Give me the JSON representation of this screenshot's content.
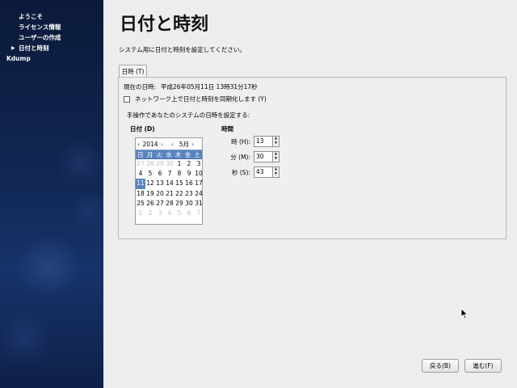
{
  "sidebar": {
    "items": [
      {
        "label": "ようこそ",
        "active": false
      },
      {
        "label": "ライセンス情報",
        "active": false
      },
      {
        "label": "ユーザーの作成",
        "active": false
      },
      {
        "label": "日付と時刻",
        "active": true
      },
      {
        "label": "Kdump",
        "active": false
      }
    ]
  },
  "header": {
    "title": "日付と時刻",
    "subtitle": "システム用に日付と時刻を設定してください。"
  },
  "tab": {
    "label": "日時 (T)"
  },
  "panel": {
    "current_time_label": "現在の日時:",
    "current_time_value": "平成26年05月11日 13時31分17秒",
    "ntp_label": "ネットワーク上で日付と時刻を同期化します (Y)",
    "ntp_checked": false,
    "manual_label": "手操作であなたのシステムの日時を設定する:",
    "date_header": "日付 (D)",
    "time_header": "時間"
  },
  "calendar": {
    "year": "2014",
    "month": "5月",
    "prev_symbol": "‹",
    "next_symbol": "›",
    "weekdays": [
      "日",
      "月",
      "火",
      "水",
      "木",
      "金",
      "土"
    ],
    "days": [
      {
        "d": "27",
        "other": true
      },
      {
        "d": "28",
        "other": true
      },
      {
        "d": "29",
        "other": true
      },
      {
        "d": "30",
        "other": true
      },
      {
        "d": "1"
      },
      {
        "d": "2"
      },
      {
        "d": "3"
      },
      {
        "d": "4"
      },
      {
        "d": "5"
      },
      {
        "d": "6"
      },
      {
        "d": "7"
      },
      {
        "d": "8"
      },
      {
        "d": "9"
      },
      {
        "d": "10"
      },
      {
        "d": "11",
        "selected": true
      },
      {
        "d": "12"
      },
      {
        "d": "13"
      },
      {
        "d": "14"
      },
      {
        "d": "15"
      },
      {
        "d": "16"
      },
      {
        "d": "17"
      },
      {
        "d": "18"
      },
      {
        "d": "19"
      },
      {
        "d": "20"
      },
      {
        "d": "21"
      },
      {
        "d": "22"
      },
      {
        "d": "23"
      },
      {
        "d": "24"
      },
      {
        "d": "25"
      },
      {
        "d": "26"
      },
      {
        "d": "27"
      },
      {
        "d": "28"
      },
      {
        "d": "29"
      },
      {
        "d": "30"
      },
      {
        "d": "31"
      },
      {
        "d": "1",
        "other": true
      },
      {
        "d": "2",
        "other": true
      },
      {
        "d": "3",
        "other": true
      },
      {
        "d": "4",
        "other": true
      },
      {
        "d": "5",
        "other": true
      },
      {
        "d": "6",
        "other": true
      },
      {
        "d": "7",
        "other": true
      }
    ]
  },
  "time": {
    "hour_label": "時 (H):",
    "hour_value": "13",
    "minute_label": "分 (M):",
    "minute_value": "30",
    "second_label": "秒 (S):",
    "second_value": "43"
  },
  "buttons": {
    "back_label": "戻る(B)",
    "next_label": "進む(F)"
  },
  "colors": {
    "sidebar_bg": "#10254f",
    "selection": "#5a84c0"
  },
  "icons": {
    "active_marker": "triangle-right-icon",
    "cursor": "mouse-pointer-icon"
  }
}
